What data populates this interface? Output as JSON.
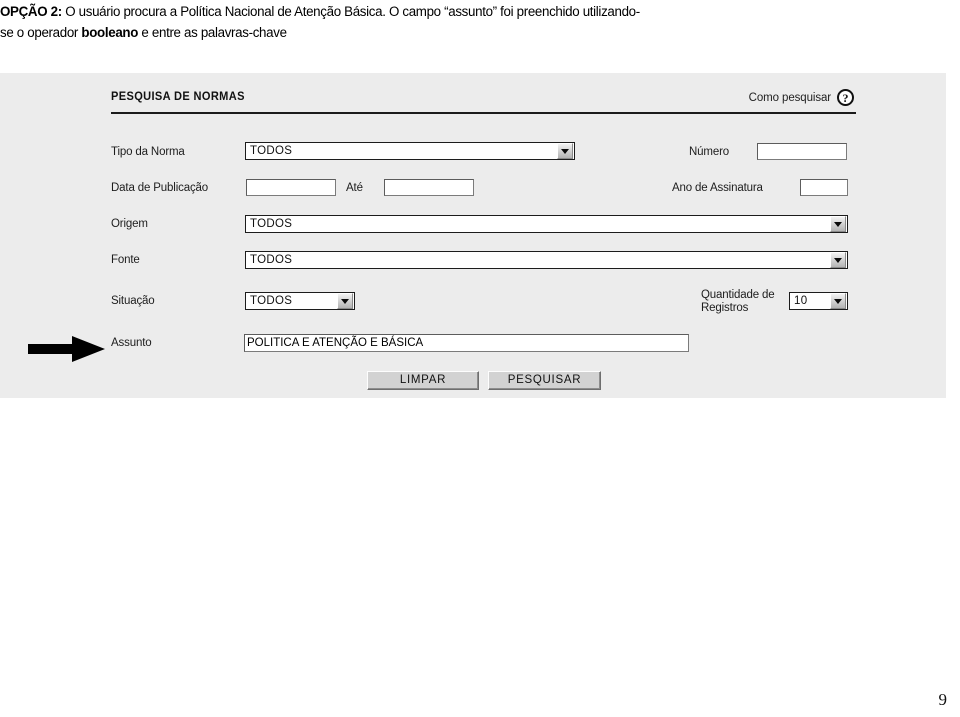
{
  "caption": {
    "prefix_bold": "OPÇÃO 2:",
    "line1_rest": " O usuário procura a Política Nacional de Atenção Básica. O campo “assunto” foi preenchido utilizando-",
    "line2_a": "se o operador ",
    "line2_bold": "booleano",
    "line2_b": " e entre as palavras-chave"
  },
  "form": {
    "title": "PESQUISA DE NORMAS",
    "help_label": "Como pesquisar",
    "help_icon_glyph": "?",
    "fields": {
      "tipo_norma": {
        "label": "Tipo da Norma",
        "value": "TODOS"
      },
      "numero": {
        "label": "Número",
        "value": ""
      },
      "data_publicacao": {
        "label": "Data de Publicação",
        "value": ""
      },
      "ate": {
        "label": "Até",
        "value": ""
      },
      "ano_assinatura": {
        "label": "Ano de Assinatura",
        "value": ""
      },
      "origem": {
        "label": "Origem",
        "value": "TODOS"
      },
      "fonte": {
        "label": "Fonte",
        "value": "TODOS"
      },
      "situacao": {
        "label": "Situação",
        "value": "TODOS"
      },
      "quantidade_registros": {
        "label_line1": "Quantidade de",
        "label_line2": "Registros",
        "value": "10"
      },
      "assunto": {
        "label": "Assunto",
        "value": "POLITICA E ATENÇÃO E BÁSICA"
      }
    },
    "buttons": {
      "limpar": "LIMPAR",
      "pesquisar": "PESQUISAR"
    }
  },
  "annotation": {
    "arrow_icon": "right-arrow-icon"
  },
  "page_number": "9",
  "colors": {
    "panel_bg": "#ececec",
    "text": "#1d1d1d",
    "rule": "#1b1b1b",
    "input_bg": "#ffffff",
    "button_bg": "#d2d2d2"
  }
}
